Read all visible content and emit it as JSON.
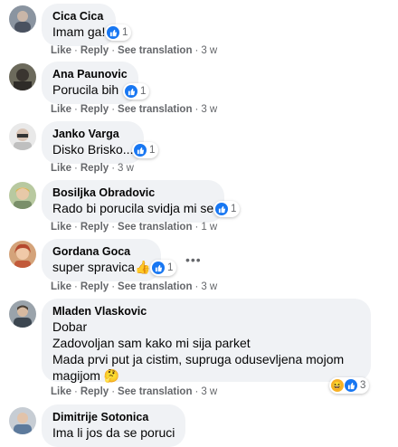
{
  "actions": {
    "like": "Like",
    "reply": "Reply",
    "see_translation": "See translation",
    "separator": "·"
  },
  "comments": [
    {
      "author": "Cica Cica",
      "text": "Imam ga!",
      "reactions": "1",
      "time": "3 w",
      "translation": true
    },
    {
      "author": "Ana Paunovic",
      "text": "Porucila bih",
      "reactions": "1",
      "time": "3 w",
      "translation": true
    },
    {
      "author": "Janko Varga",
      "text": "Disko Brisko...",
      "reactions": "1",
      "time": "3 w",
      "translation": false
    },
    {
      "author": "Bosiljka Obradovic",
      "text": "Rado bi porucila svidja mi se",
      "reactions": "1",
      "time": "1 w",
      "translation": true
    },
    {
      "author": "Gordana Goca",
      "text": "super spravica👍",
      "reactions": "1",
      "time": "3 w",
      "translation": true,
      "more_options": "•••"
    },
    {
      "author": "Mladen Vlaskovic",
      "lines": [
        "Dobar",
        "Zadovoljan sam kako mi sija parket",
        "Mada prvi put ja cistim, supruga odusevljena mojom",
        "magijom 🤔"
      ],
      "reactions": "3",
      "time": "3 w",
      "translation": true
    },
    {
      "author": "Dimitrije Sotonica",
      "text": "Ima li jos da se poruci"
    }
  ],
  "colors": {
    "like_blue": "#1877f2",
    "bubble": "#f0f2f5",
    "meta": "#65676b"
  },
  "icons": {
    "like": "thumbs-up-icon",
    "haha": "haha-icon"
  }
}
